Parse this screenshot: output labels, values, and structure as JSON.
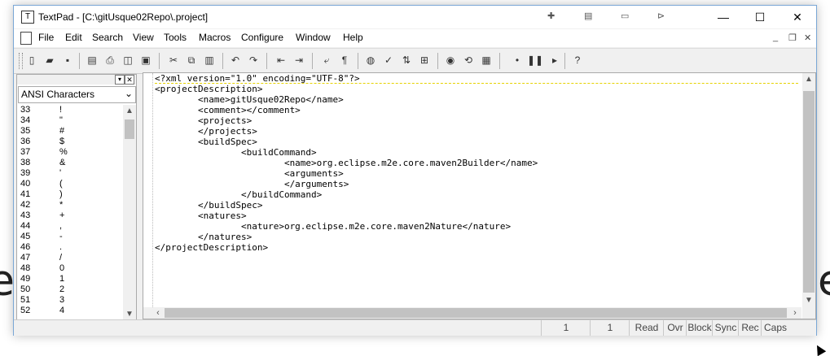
{
  "window": {
    "title": "TextPad - [C:\\gitUsque02Repo\\.project]",
    "minimize": "—",
    "maximize": "☐",
    "close": "✕"
  },
  "menubar": {
    "items": [
      "File",
      "Edit",
      "Search",
      "View",
      "Tools",
      "Macros",
      "Configure",
      "Window",
      "Help"
    ]
  },
  "left_panel": {
    "dropdown_value": "ANSI Characters",
    "chars": [
      {
        "n": "33",
        "c": "!"
      },
      {
        "n": "34",
        "c": "\""
      },
      {
        "n": "35",
        "c": "#"
      },
      {
        "n": "36",
        "c": "$"
      },
      {
        "n": "37",
        "c": "%"
      },
      {
        "n": "38",
        "c": "&"
      },
      {
        "n": "39",
        "c": "'"
      },
      {
        "n": "40",
        "c": "("
      },
      {
        "n": "41",
        "c": ")"
      },
      {
        "n": "42",
        "c": "*"
      },
      {
        "n": "43",
        "c": "+"
      },
      {
        "n": "44",
        "c": ","
      },
      {
        "n": "45",
        "c": "-"
      },
      {
        "n": "46",
        "c": "."
      },
      {
        "n": "47",
        "c": "/"
      },
      {
        "n": "48",
        "c": "0"
      },
      {
        "n": "49",
        "c": "1"
      },
      {
        "n": "50",
        "c": "2"
      },
      {
        "n": "51",
        "c": "3"
      },
      {
        "n": "52",
        "c": "4"
      }
    ]
  },
  "editor": {
    "lines": [
      "<?xml version=\"1.0\" encoding=\"UTF-8\"?>",
      "<projectDescription>",
      "        <name>gitUsque02Repo</name>",
      "        <comment></comment>",
      "        <projects>",
      "        </projects>",
      "        <buildSpec>",
      "                <buildCommand>",
      "                        <name>org.eclipse.m2e.core.maven2Builder</name>",
      "                        <arguments>",
      "                        </arguments>",
      "                </buildCommand>",
      "        </buildSpec>",
      "        <natures>",
      "                <nature>org.eclipse.m2e.core.maven2Nature</nature>",
      "        </natures>",
      "</projectDescription>"
    ]
  },
  "statusbar": {
    "line": "1",
    "col": "1",
    "read": "Read",
    "ovr": "Ovr",
    "block": "Block",
    "sync": "Sync",
    "rec": "Rec",
    "caps": "Caps"
  }
}
